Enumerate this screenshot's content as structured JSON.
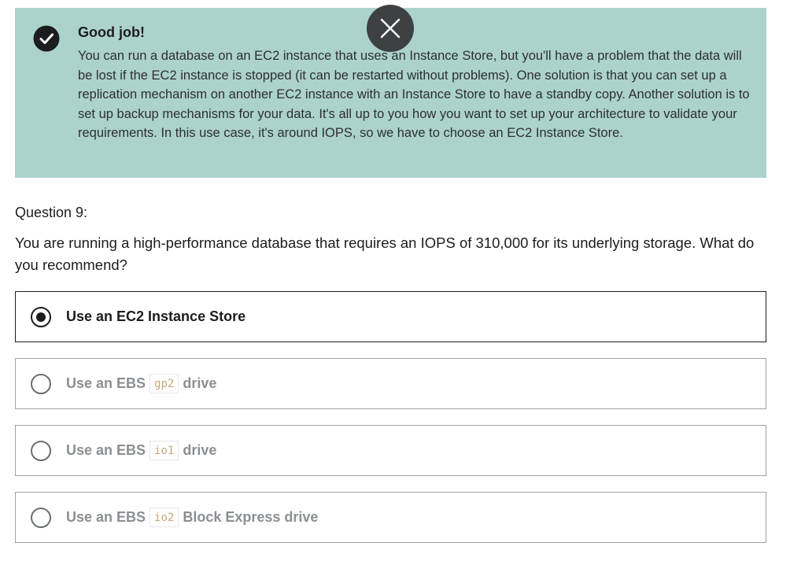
{
  "feedback": {
    "title": "Good job!",
    "body": "You can run a database on an EC2 instance that uses an Instance Store, but you'll have a problem that the data will be lost if the EC2 instance is stopped (it can be restarted without problems). One solution is that you can set up a replication mechanism on another EC2 instance with an Instance Store to have a standby copy. Another solution is to set up backup mechanisms for your data. It's all up to you how you want to set up your architecture to validate your requirements. In this use case, it's around IOPS, so we have to choose an EC2 Instance Store.",
    "background_color": "#acd2cc",
    "icons": [
      "check-circle-icon",
      "close-icon"
    ]
  },
  "question": {
    "label": "Question 9:",
    "text": "You are running a high-performance database that requires an IOPS of 310,000 for its underlying storage. What do you recommend?"
  },
  "options": [
    {
      "prefix": "Use an EC2 Instance Store",
      "code": "",
      "suffix": "",
      "selected": true
    },
    {
      "prefix": "Use an EBS",
      "code": "gp2",
      "suffix": "drive",
      "selected": false
    },
    {
      "prefix": "Use an EBS",
      "code": "io1",
      "suffix": "drive",
      "selected": false
    },
    {
      "prefix": "Use an EBS",
      "code": "io2",
      "suffix": "Block Express drive",
      "selected": false
    }
  ]
}
